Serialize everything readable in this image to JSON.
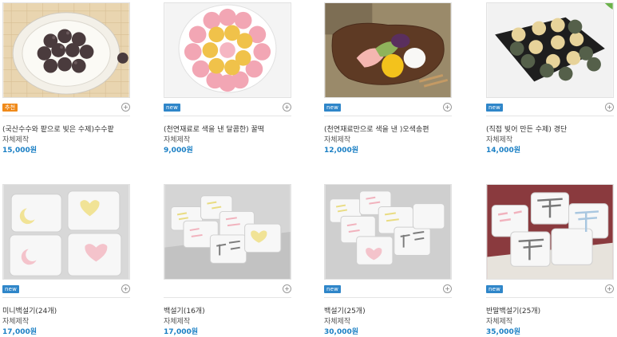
{
  "colors": {
    "badge_new": "#2f86c9",
    "badge_recommend": "#f08a1a",
    "price": "#1a7fc4"
  },
  "products": [
    {
      "badge": "추천",
      "badge_color": "#f08a1a",
      "title": "(국산수수와 팥으로 빚은 수제)수수팥",
      "maker": "자체제작",
      "price": "15,000원",
      "image": "sorghum-bean-balls"
    },
    {
      "badge": "new",
      "badge_color": "#2f86c9",
      "title": "(천연재료로 색을 낸 달콤한) 꿀떡",
      "maker": "자체제작",
      "price": "9,000원",
      "image": "honey-rice-cake"
    },
    {
      "badge": "new",
      "badge_color": "#2f86c9",
      "title": "(천연재료만으로 색을 낸 )오색송편",
      "maker": "자체제작",
      "price": "12,000원",
      "image": "five-color-songpyeon"
    },
    {
      "badge": "new",
      "badge_color": "#2f86c9",
      "title": "(직접 빚어 만든 수제) 경단",
      "maker": "자체제작",
      "price": "14,000원",
      "image": "gyeongdan"
    },
    {
      "badge": "new",
      "badge_color": "#2f86c9",
      "title": "미니백설기(24개)",
      "maker": "자체제작",
      "price": "17,000원",
      "image": "mini-baekseolgi"
    },
    {
      "badge": "",
      "badge_color": "",
      "title": "백설기(16개)",
      "maker": "자체제작",
      "price": "17,000원",
      "image": "baekseolgi-16"
    },
    {
      "badge": "new",
      "badge_color": "#2f86c9",
      "title": "백설기(25개)",
      "maker": "자체제작",
      "price": "30,000원",
      "image": "baekseolgi-25"
    },
    {
      "badge": "new",
      "badge_color": "#2f86c9",
      "title": "반말백설기(25개)",
      "maker": "자체제작",
      "price": "35,000원",
      "image": "banmal-baekseolgi"
    }
  ],
  "plus_symbol": "+"
}
